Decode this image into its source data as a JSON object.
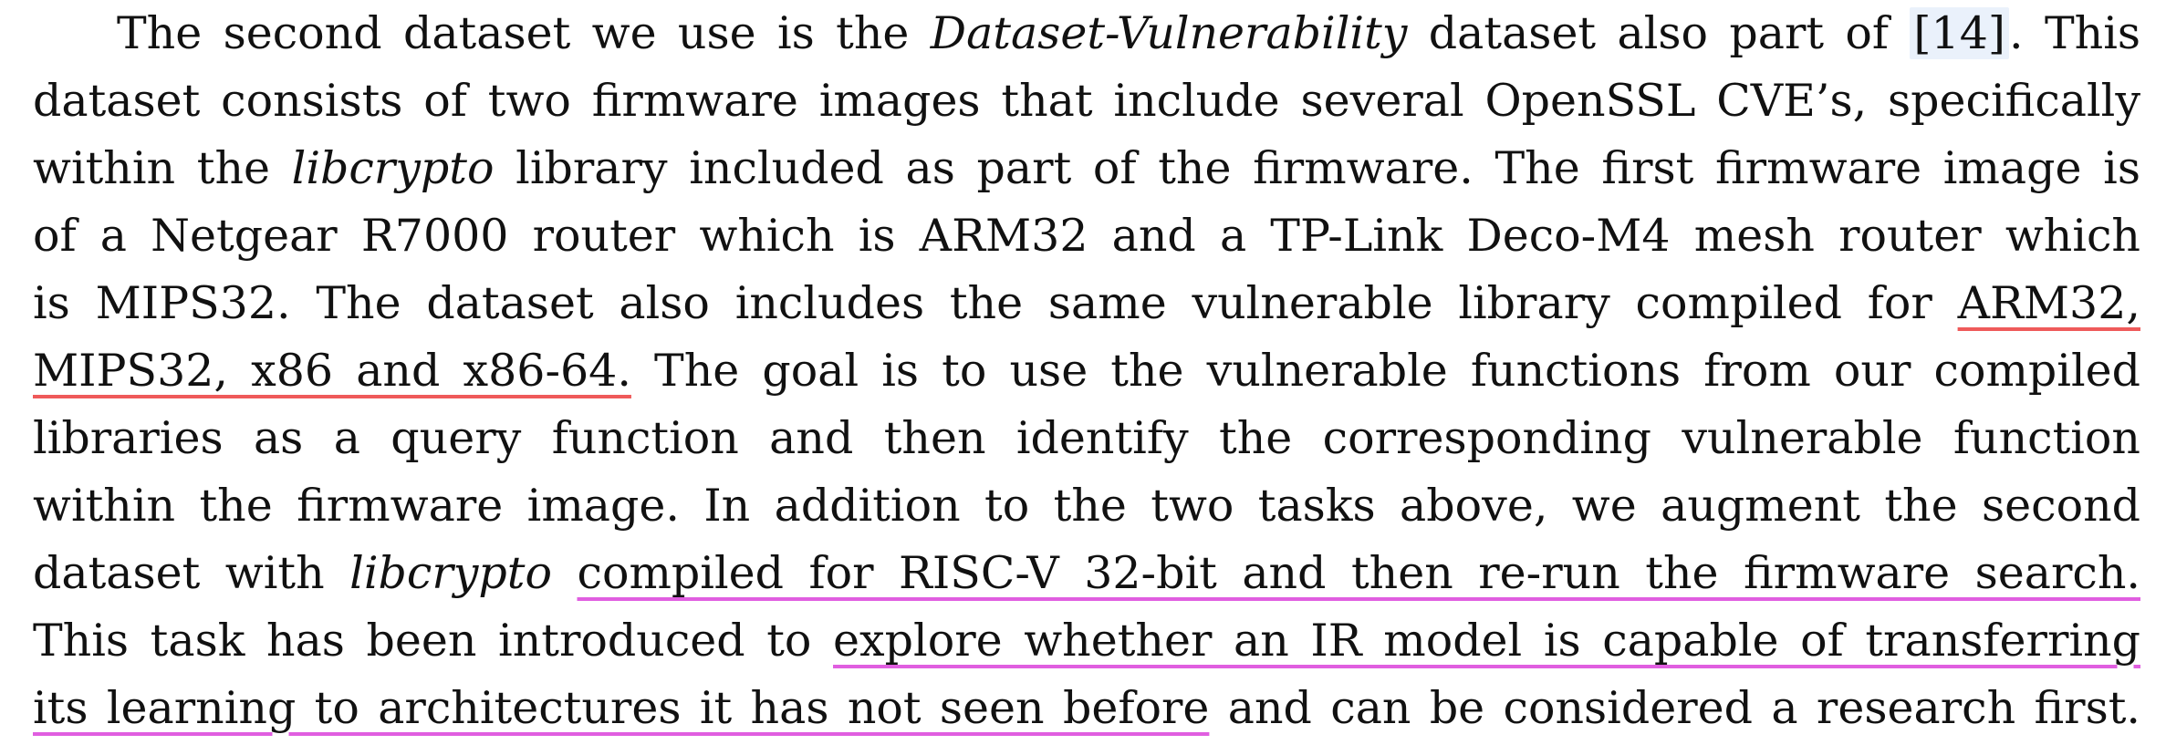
{
  "paragraph": {
    "l1": {
      "a": "The second dataset we use is the ",
      "b": "Dataset-Vulnerability",
      "c": " dataset also part of ",
      "ref": "[14]",
      "d": ". This"
    },
    "l2": "dataset consists of two firmware images that include several OpenSSL CVE’s, specifically",
    "l3": {
      "a": "within the ",
      "b": "libcrypto",
      "c": " library included as part of the firmware. The first firmware image is"
    },
    "l4": "of a Netgear R7000 router which is ARM32 and a TP-Link Deco-M4 mesh router which",
    "l5": {
      "a": "is MIPS32. The dataset also includes the same vulnerable library compiled for ",
      "b": "ARM32,"
    },
    "l6": {
      "a": "MIPS32, x86 and x86-64.",
      "b": " The goal is to use the vulnerable functions from our compiled"
    },
    "l7": "libraries as a query function and then identify the corresponding vulnerable function",
    "l8": "within the firmware image. In addition to the two tasks above, we augment the second",
    "l9": {
      "a": "dataset with ",
      "b": "libcrypto",
      "c": " ",
      "d": "compiled for RISC-V 32-bit and then re-run the firmware search."
    },
    "l10": {
      "a": "This task has been introduced to ",
      "b": "explore whether an IR model is capable of transferring"
    },
    "l11": {
      "a": "its learning to architectures it has not seen before",
      "b": " and can be considered a research first."
    }
  }
}
